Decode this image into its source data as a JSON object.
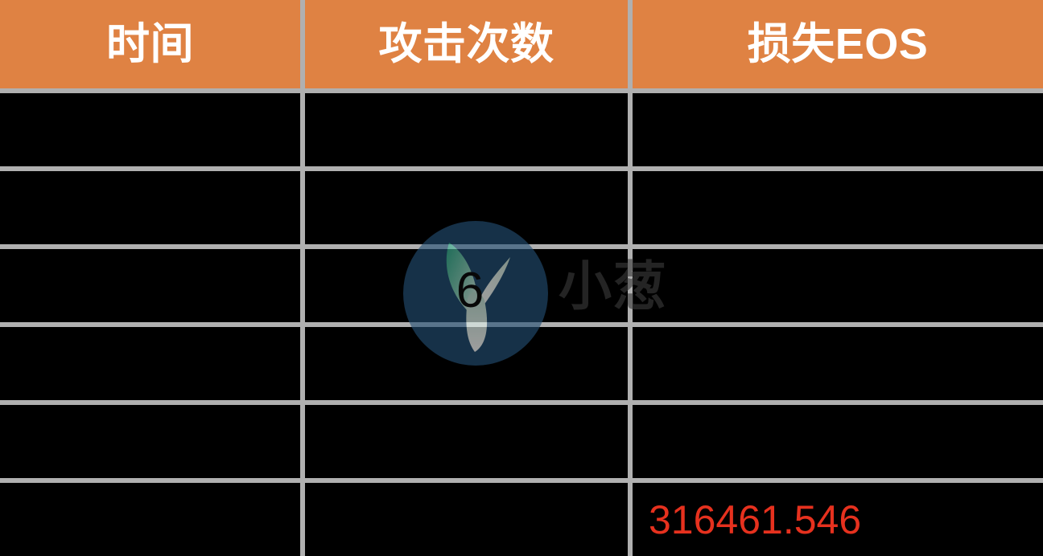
{
  "table": {
    "columns": [
      {
        "key": "time",
        "label": "时间"
      },
      {
        "key": "count",
        "label": "攻击次数"
      },
      {
        "key": "loss",
        "label": "损失EOS"
      }
    ],
    "header_bg": "#df8243",
    "header_text_color": "#ffffff",
    "body_bg": "#000000",
    "border_color": "#b0b0b0",
    "highlight_color": "#e6311e",
    "rows": [
      {
        "time": "",
        "count": "",
        "loss": ""
      },
      {
        "time": "",
        "count": "",
        "loss": ""
      },
      {
        "time": "",
        "count": "",
        "loss": ""
      },
      {
        "time": "",
        "count": "",
        "loss": ""
      },
      {
        "time": "",
        "count": "",
        "loss": ""
      },
      {
        "time": "",
        "count": "",
        "loss": "316461.546"
      }
    ]
  },
  "watermark": {
    "text": "小葱",
    "digit": "6",
    "circle_color": "#255075",
    "leaf_color_start": "#2fae8e",
    "leaf_color_end": "#f3fbf7",
    "text_color": "#3b3b3b",
    "icon_name": "sprout-logo-icon"
  }
}
